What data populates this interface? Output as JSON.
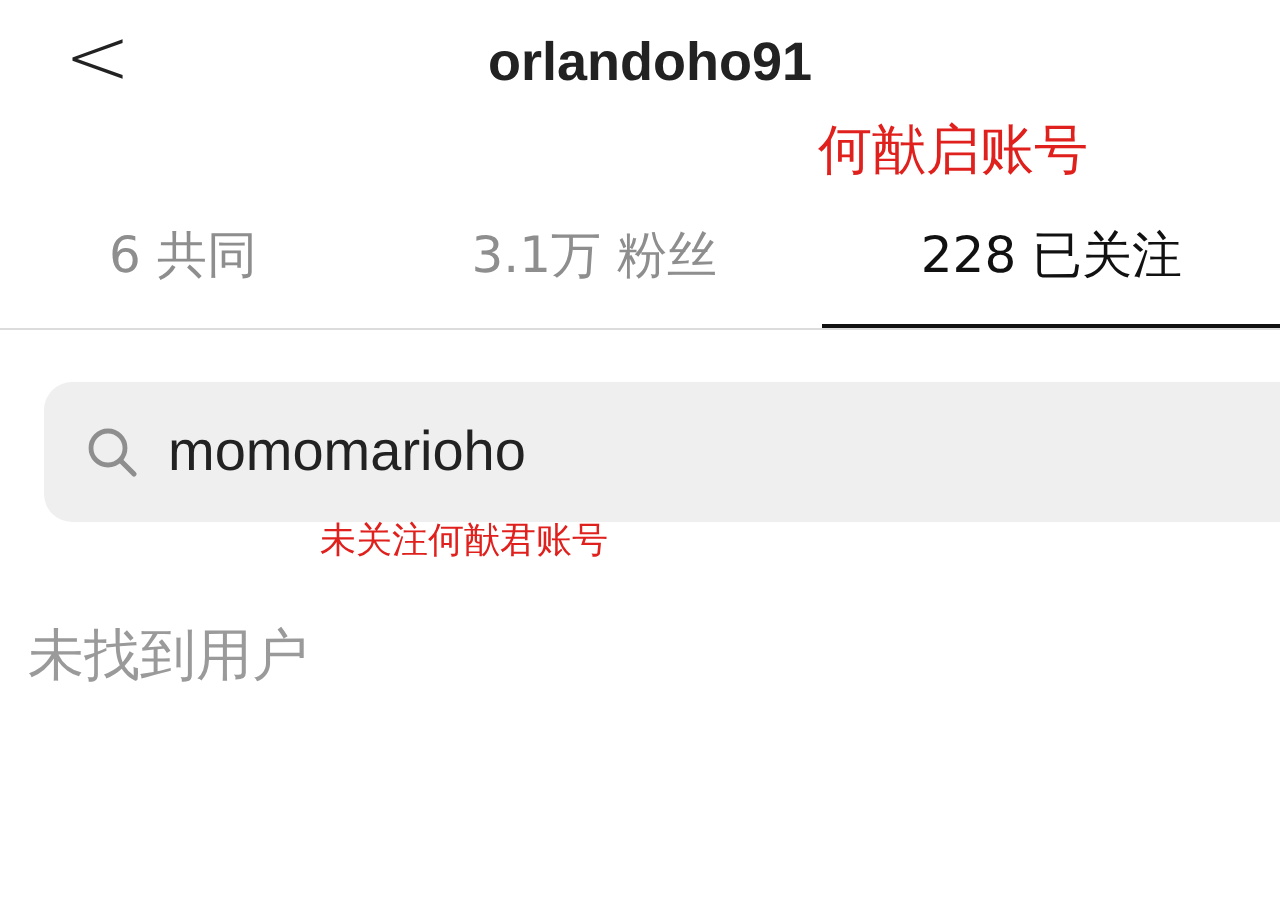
{
  "header": {
    "back": "<",
    "title": "orlandoho91"
  },
  "annotations": [
    {
      "text": "何猷启账号"
    },
    {
      "text": "未关注何猷君账号"
    }
  ],
  "tabs": [
    {
      "label": "6 共同",
      "selected": false
    },
    {
      "label": "3.1万 粉丝",
      "selected": false
    },
    {
      "label": "228 已关注",
      "selected": true
    }
  ],
  "search": {
    "value": "momomarioho"
  },
  "empty_message": "未找到用户"
}
